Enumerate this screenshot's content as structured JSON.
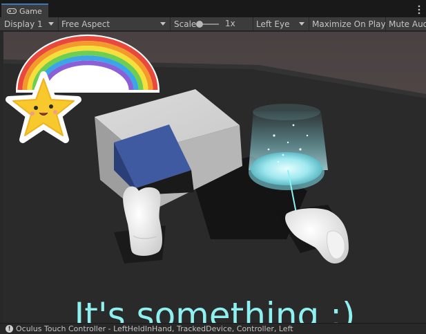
{
  "tab": {
    "label": "Game",
    "icon": "gamepad-icon"
  },
  "toolbar": {
    "display": "Display 1",
    "aspect": "Free Aspect",
    "scale_label": "Scale",
    "scale_value": "1x",
    "eye": "Left Eye",
    "maximize": "Maximize On Play",
    "mute": "Mute Audio"
  },
  "scene": {
    "caption": "It's something :)",
    "colors": {
      "caption": "#8ef0ef",
      "cube": "#3f5aa0",
      "hologram": "#8fe8f2"
    },
    "stickers": [
      "rainbow-sticker",
      "star-sticker"
    ]
  },
  "status": {
    "icon": "info-icon",
    "message": "Oculus Touch Controller - LeftHeldInHand, TrackedDevice, Controller, Left"
  }
}
